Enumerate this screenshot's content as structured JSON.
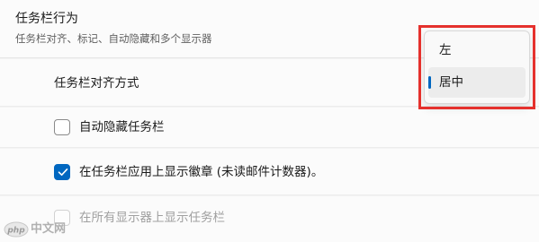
{
  "section": {
    "title": "任务栏行为",
    "subtitle": "任务栏对齐、标记、自动隐藏和多个显示器"
  },
  "alignment": {
    "label": "任务栏对齐方式",
    "options": [
      "左",
      "居中"
    ],
    "selected": "居中"
  },
  "checkboxes": {
    "autohide": {
      "label": "自动隐藏任务栏",
      "checked": false,
      "enabled": true
    },
    "badges": {
      "label": "在任务栏应用上显示徽章 (未读邮件计数器)。",
      "checked": true,
      "enabled": true
    },
    "multi_display": {
      "label": "在所有显示器上显示任务栏",
      "checked": false,
      "enabled": false
    }
  },
  "colors": {
    "accent": "#0067c0",
    "highlight": "#e5312d"
  },
  "watermark": {
    "text": "中文网",
    "logo_text": "php"
  }
}
